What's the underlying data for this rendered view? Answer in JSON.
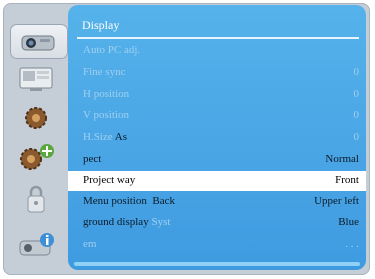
{
  "menu": {
    "title": "Display",
    "items": [
      {
        "label": "Auto PC adj.",
        "value": ""
      },
      {
        "label": "Fine sync",
        "value": "0"
      },
      {
        "label": "H position",
        "value": "0"
      },
      {
        "label": "V position",
        "value": "0"
      },
      {
        "label": "H.Size",
        "label_tail": "As",
        "value": "0"
      },
      {
        "label": "pect",
        "value": "Normal"
      },
      {
        "label": "Project way",
        "value": "Front"
      },
      {
        "label": "Menu position",
        "label_tail": "Back",
        "value": "Upper left"
      },
      {
        "label": "ground display",
        "label_tail": "Syst",
        "value": "Blue"
      },
      {
        "label": "em",
        "value": ". . ."
      }
    ]
  },
  "sidebar": {
    "items": [
      {
        "icon": "projector-icon"
      },
      {
        "icon": "screen-icon"
      },
      {
        "icon": "gear-icon"
      },
      {
        "icon": "gears-plus-icon"
      },
      {
        "icon": "lock-icon"
      },
      {
        "icon": "info-icon"
      }
    ]
  },
  "colors": {
    "panel": "#4aa8e6",
    "frame": "#c5cdd6",
    "selected_row": "#ffffff",
    "disabled_text": "#9ed0f2"
  }
}
